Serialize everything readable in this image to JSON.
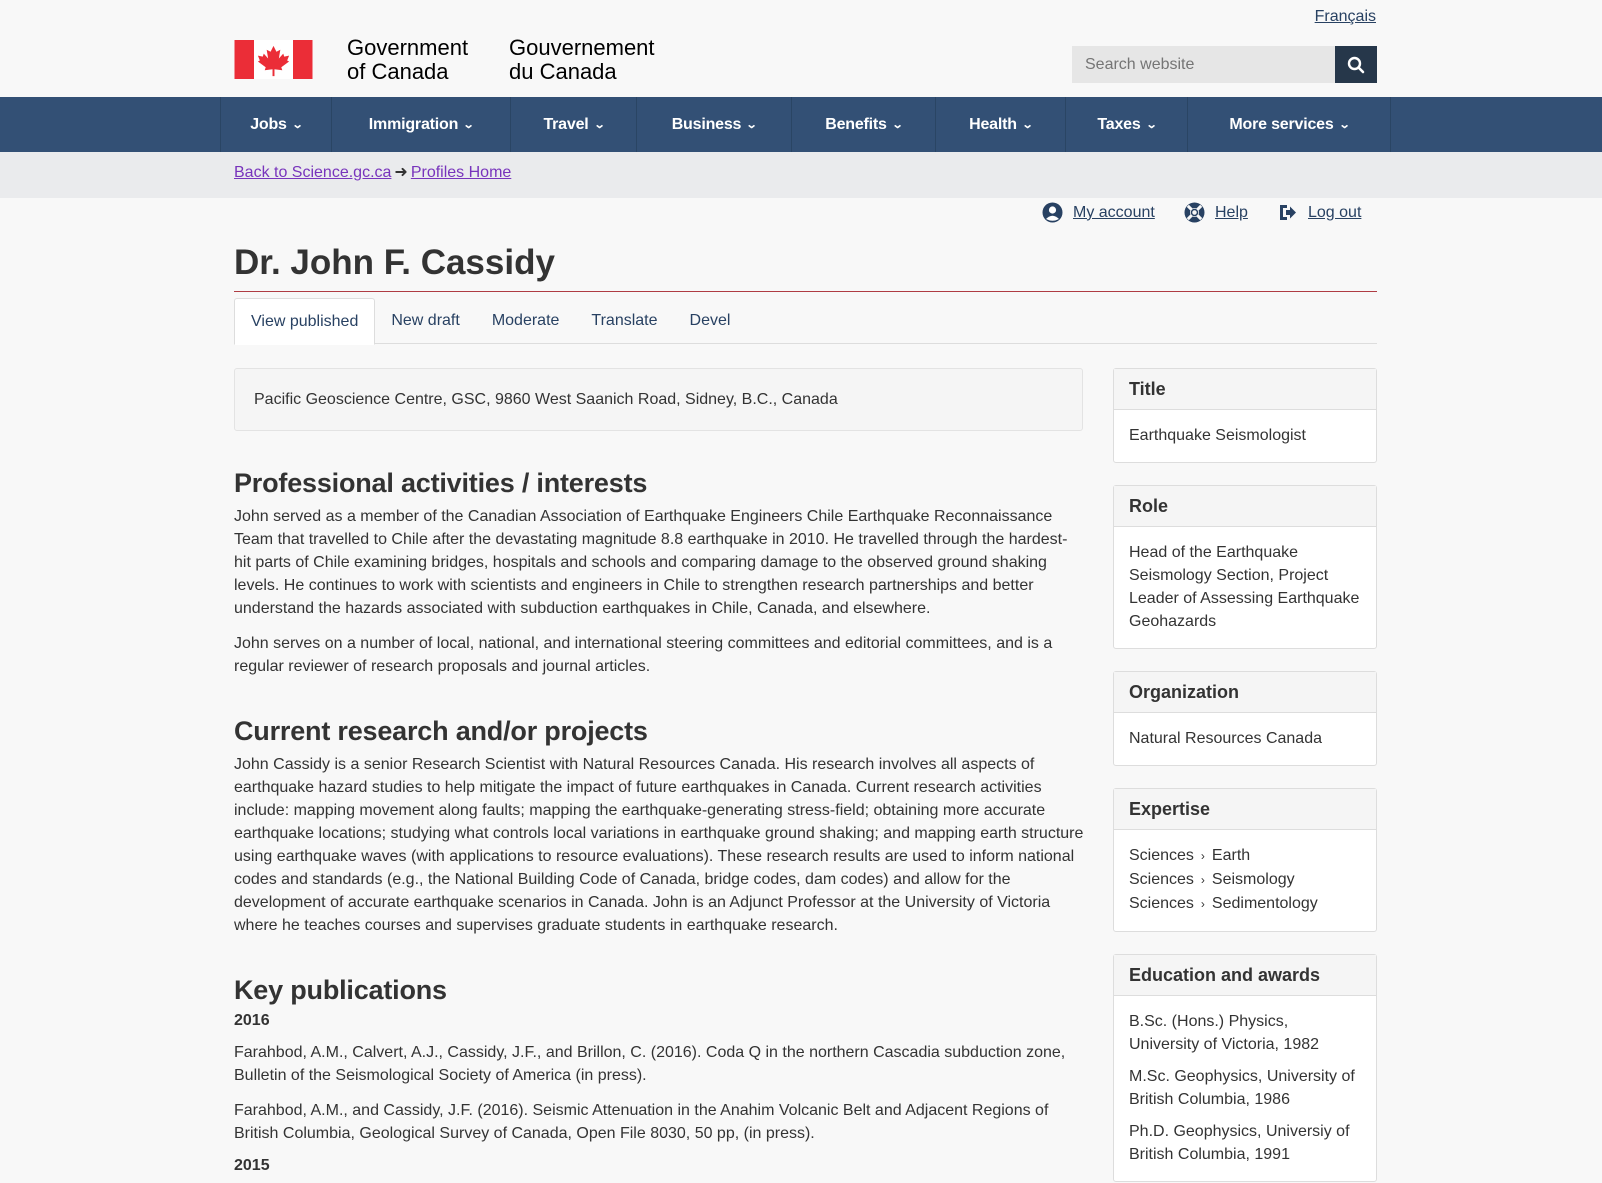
{
  "header": {
    "lang_link": "Français",
    "signature_en_line1": "Government",
    "signature_en_line2": "of Canada",
    "signature_fr_line1": "Gouvernement",
    "signature_fr_line2": "du Canada",
    "search_placeholder": "Search website"
  },
  "menu": [
    {
      "label": "Jobs"
    },
    {
      "label": "Immigration"
    },
    {
      "label": "Travel"
    },
    {
      "label": "Business"
    },
    {
      "label": "Benefits"
    },
    {
      "label": "Health"
    },
    {
      "label": "Taxes"
    },
    {
      "label": "More services"
    }
  ],
  "breadcrumb": {
    "item1": "Back to Science.gc.ca",
    "item2": "Profiles Home"
  },
  "account": {
    "my_account": "My account",
    "help": "Help",
    "logout": "Log out"
  },
  "page_title": "Dr. John F. Cassidy",
  "tabs": [
    {
      "label": "View published",
      "active": true
    },
    {
      "label": "New draft"
    },
    {
      "label": "Moderate"
    },
    {
      "label": "Translate"
    },
    {
      "label": "Devel"
    }
  ],
  "address": "Pacific Geoscience Centre, GSC, 9860 West Saanich Road, Sidney, B.C., Canada",
  "sections": {
    "activities": {
      "heading": "Professional activities / interests",
      "p1": "John served as a member of the Canadian Association of Earthquake Engineers Chile Earthquake Reconnaissance Team that travelled to Chile after the devastating magnitude 8.8 earthquake in 2010. He travelled through the hardest-hit parts of Chile examining bridges, hospitals and schools and comparing damage to the observed ground shaking levels.  He continues to work with scientists and engineers in Chile to strengthen research partnerships and better understand the hazards associated with subduction earthquakes in Chile, Canada, and elsewhere.",
      "p2": "John serves on a number of local, national, and international steering committees and editorial committees, and is a regular reviewer of research proposals and journal articles."
    },
    "research": {
      "heading": "Current research and/or projects",
      "p1": "John Cassidy is a senior Research Scientist with Natural Resources Canada. His research involves all aspects of earthquake hazard studies to help mitigate the impact of future earthquakes in Canada. Current research activities include: mapping movement along faults; mapping the earthquake-generating stress-field; obtaining more accurate earthquake locations; studying what controls local variations in earthquake ground shaking; and mapping earth structure using earthquake waves (with applications to resource evaluations). These research results are used to inform national codes and standards (e.g., the National Building Code of Canada, bridge codes, dam codes) and  allow for the development of accurate earthquake scenarios in Canada. John is an Adjunct Professor at the University of Victoria where he teaches courses and supervises graduate students in earthquake research."
    },
    "publications": {
      "heading": "Key publications",
      "year1": "2016",
      "pub1": "Farahbod, A.M., Calvert, A.J., Cassidy, J.F., and Brillon, C. (2016). Coda Q in the northern Cascadia subduction zone, Bulletin of the Seismological Society of America (in press).",
      "pub2": "Farahbod, A.M., and Cassidy, J.F. (2016). Seismic Attenuation in the Anahim Volcanic Belt and Adjacent Regions of British Columbia, Geological Survey of Canada, Open File 8030, 50 pp, (in press).",
      "year2": "2015"
    }
  },
  "sidebar": {
    "title": {
      "heading": "Title",
      "body": "Earthquake Seismologist"
    },
    "role": {
      "heading": "Role",
      "body": "Head of the Earthquake Seismology Section, Project Leader of Assessing Earthquake Geohazards"
    },
    "organization": {
      "heading": "Organization",
      "body": "Natural Resources Canada"
    },
    "expertise": {
      "heading": "Expertise",
      "separator": "›",
      "rows": [
        {
          "parent": "Sciences",
          "child": "Earth"
        },
        {
          "parent": "Sciences",
          "child": "Seismology"
        },
        {
          "parent": "Sciences",
          "child": "Sedimentology"
        }
      ]
    },
    "education": {
      "heading": "Education and awards",
      "items": [
        "B.Sc. (Hons.) Physics, University of Victoria, 1982",
        "M.Sc. Geophysics, University of British Columbia, 1986",
        "Ph.D. Geophysics, Universiy of British Columbia, 1991"
      ]
    }
  }
}
